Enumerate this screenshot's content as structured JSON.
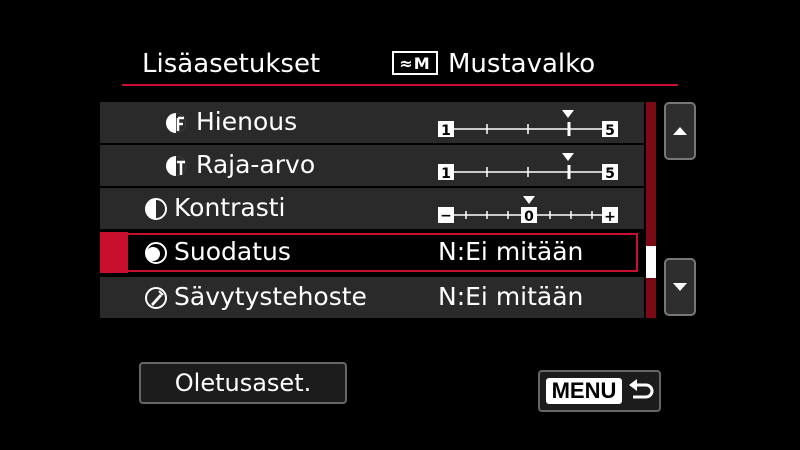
{
  "header": {
    "title": "Lisäasetukset",
    "style_badge_text": "≈M",
    "style_name": "Mustavalko"
  },
  "rows": [
    {
      "label": "Hienous",
      "icon": "fineness-icon",
      "control": "slider",
      "slider": {
        "min_label": "1",
        "max_label": "5",
        "value": 4
      }
    },
    {
      "label": "Raja-arvo",
      "icon": "threshold-icon",
      "control": "slider",
      "slider": {
        "min_label": "1",
        "max_label": "5",
        "value": 4
      }
    },
    {
      "label": "Kontrasti",
      "icon": "contrast-icon",
      "control": "contrast-slider",
      "slider": {
        "min_label": "−",
        "max_label": "+",
        "center_label": "0",
        "value": 0
      }
    },
    {
      "label": "Suodatus",
      "icon": "filter-effect-icon",
      "control": "value",
      "value": "N:Ei mitään",
      "selected": true
    },
    {
      "label": "Sävytystehoste",
      "icon": "toning-effect-icon",
      "control": "value",
      "value": "N:Ei mitään"
    }
  ],
  "buttons": {
    "defaults_label": "Oletusaset.",
    "menu_label": "MENU"
  },
  "colors": {
    "accent": "#c8102e",
    "row_bg": "#2a2a2a",
    "background": "#000000"
  }
}
